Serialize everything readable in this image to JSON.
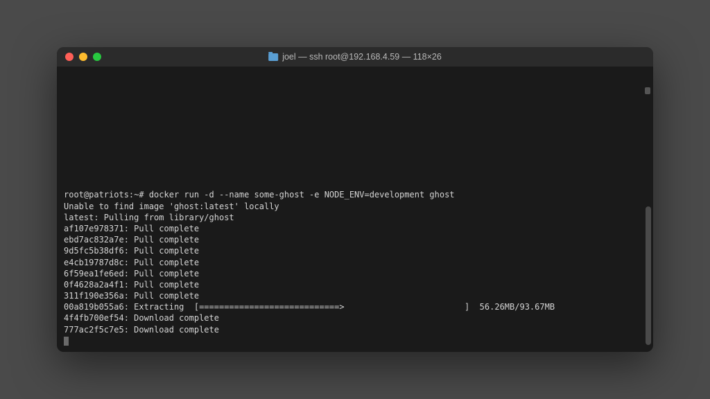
{
  "titlebar": {
    "title": "joel — ssh root@192.168.4.59 — 118×26"
  },
  "traffic": {
    "close": "close-window",
    "minimize": "minimize-window",
    "maximize": "maximize-window"
  },
  "terminal": {
    "prompt": "root@patriots:~# ",
    "command": "docker run -d --name some-ghost -e NODE_ENV=development ghost",
    "lines": [
      "Unable to find image 'ghost:latest' locally",
      "latest: Pulling from library/ghost",
      "af107e978371: Pull complete",
      "ebd7ac832a7e: Pull complete",
      "9d5fc5b38df6: Pull complete",
      "e4cb19787d8c: Pull complete",
      "6f59ea1fe6ed: Pull complete",
      "0f4628a2a4f1: Pull complete",
      "311f190e356a: Pull complete"
    ],
    "extracting": {
      "hash": "00a819b055a6",
      "label": "Extracting",
      "bar": "[============================>                        ]",
      "progress": "56.26MB/93.67MB"
    },
    "downloads": [
      "4f4fb700ef54: Download complete",
      "777ac2f5c7e5: Download complete"
    ]
  }
}
